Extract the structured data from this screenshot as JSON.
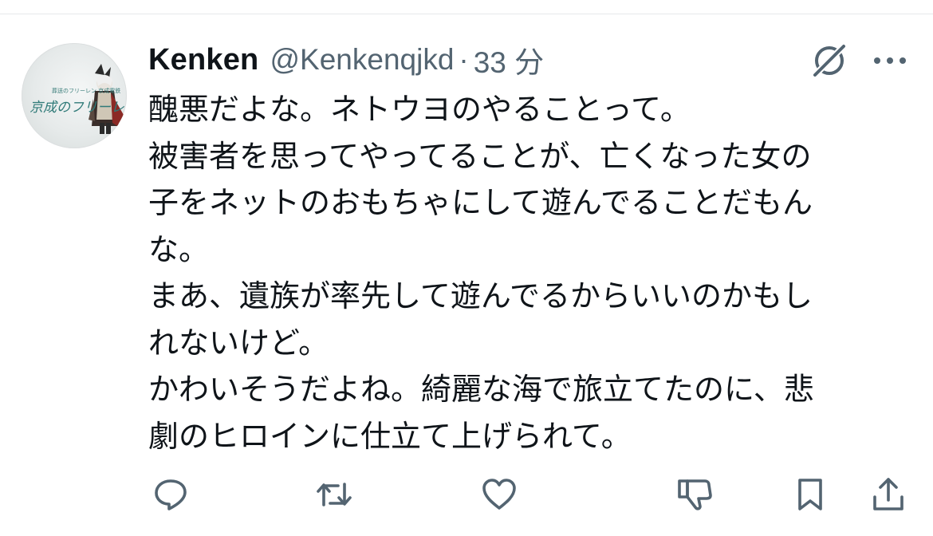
{
  "tweet": {
    "author": {
      "display_name": "Kenken",
      "handle": "@Kenkenqjkd",
      "separator": "·",
      "time": "33 分",
      "avatar_text": "京成のフリーレン"
    },
    "body_lines": [
      "醜悪だよな。ネトウヨのやることって。",
      "被害者を思ってやってることが、亡くなった女の",
      "子をネットのおもちゃにして遊んでることだもん",
      "な。",
      "まあ、遺族が率先して遊んでるからいいのかもし",
      "れないけど。",
      "かわいそうだよね。綺麗な海で旅立てたのに、悲",
      "劇のヒロインに仕立て上げられて。"
    ],
    "icons": {
      "grok": "grok-icon",
      "more": "more-icon",
      "reply": "reply-icon",
      "repost": "repost-icon",
      "like": "like-icon",
      "dislike": "dislike-icon",
      "bookmark": "bookmark-icon",
      "share": "share-icon"
    },
    "colors": {
      "text_primary": "#0f1419",
      "text_secondary": "#536471",
      "icon": "#536471",
      "divider": "#e7e9ea"
    }
  }
}
